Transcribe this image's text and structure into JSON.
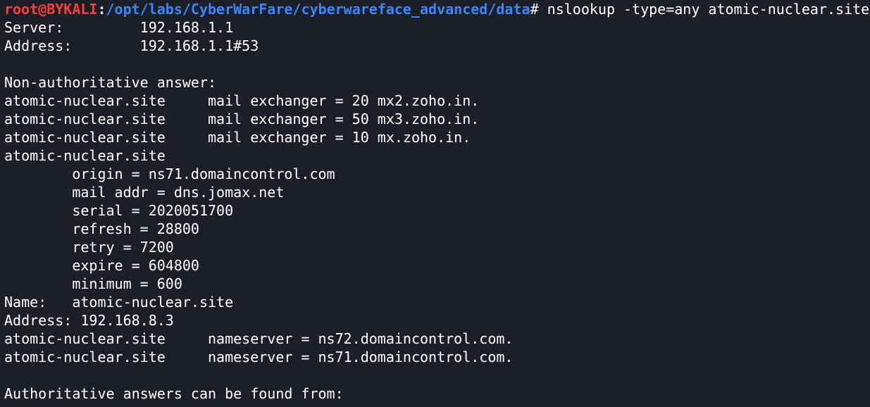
{
  "prompt": {
    "user_host": "root@BYKALI",
    "separator": ":",
    "path": "/opt/labs/CyberWarFare/cyberwareface_advanced/data",
    "sign": "#",
    "command": " nslookup -type=any atomic-nuclear.site"
  },
  "output": [
    "Server:         192.168.1.1",
    "Address:        192.168.1.1#53",
    "",
    "Non-authoritative answer:",
    "atomic-nuclear.site     mail exchanger = 20 mx2.zoho.in.",
    "atomic-nuclear.site     mail exchanger = 50 mx3.zoho.in.",
    "atomic-nuclear.site     mail exchanger = 10 mx.zoho.in.",
    "atomic-nuclear.site",
    "        origin = ns71.domaincontrol.com",
    "        mail addr = dns.jomax.net",
    "        serial = 2020051700",
    "        refresh = 28800",
    "        retry = 7200",
    "        expire = 604800",
    "        minimum = 600",
    "Name:   atomic-nuclear.site",
    "Address: 192.168.8.3",
    "atomic-nuclear.site     nameserver = ns72.domaincontrol.com.",
    "atomic-nuclear.site     nameserver = ns71.domaincontrol.com.",
    "",
    "Authoritative answers can be found from:"
  ]
}
